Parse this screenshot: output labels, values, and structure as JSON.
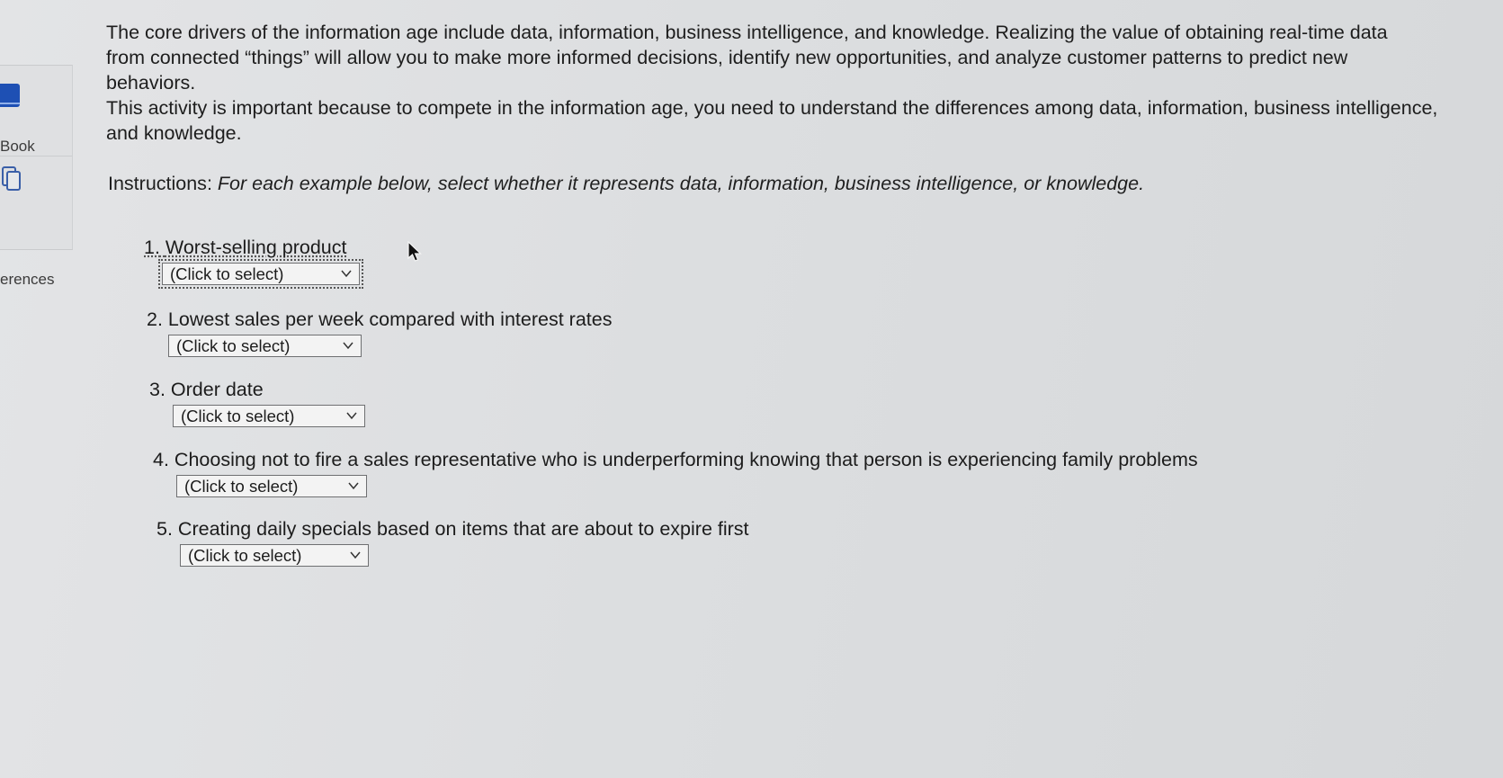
{
  "sidebar": {
    "ebook_label": "Book",
    "references_label": "erences"
  },
  "intro": {
    "paragraph1": "The core drivers of the information age include data, information, business intelligence, and knowledge. Realizing the value of obtaining real-time data from connected “things” will allow you to make more informed decisions, identify new opportunities, and analyze customer patterns to predict new behaviors.",
    "paragraph2": "This activity is important because to compete in the information age, you need to understand the differences among data, information, business intelligence, and knowledge."
  },
  "instructions": {
    "lead": "Instructions",
    "text": "For each example below, select whether it represents data, information, business intelligence, or knowledge."
  },
  "questions": [
    {
      "number": "1.",
      "text": "Worst-selling product",
      "select_value": "(Click to select)"
    },
    {
      "number": "2.",
      "text": "Lowest sales per week compared with interest rates",
      "select_value": "(Click to select)"
    },
    {
      "number": "3.",
      "text": "Order date",
      "select_value": "(Click to select)"
    },
    {
      "number": "4.",
      "text": "Choosing not to fire a sales representative who is underperforming knowing that person is experiencing family problems",
      "select_value": "(Click to select)"
    },
    {
      "number": "5.",
      "text": "Creating daily specials based on items that are about to expire first",
      "select_value": "(Click to select)"
    }
  ],
  "icons": {
    "ebook": "book-icon",
    "references": "references-icon",
    "dropdown": "chevron-down-icon",
    "cursor": "mouse-pointer-icon"
  },
  "colors": {
    "ebook_icon": "#1e50b4",
    "background": "#dcdee0"
  }
}
